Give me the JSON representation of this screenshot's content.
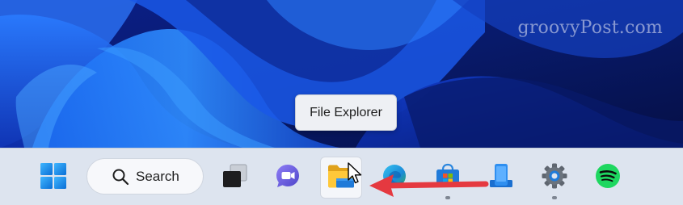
{
  "watermark": "groovyPost.com",
  "tooltip": {
    "text": "File Explorer"
  },
  "taskbar": {
    "search_label": "Search",
    "items": [
      {
        "name": "start",
        "icon": "windows-logo-icon",
        "running": false
      },
      {
        "name": "search",
        "icon": "search-icon",
        "running": false
      },
      {
        "name": "task-view",
        "icon": "task-view-icon",
        "running": false
      },
      {
        "name": "chat",
        "icon": "chat-icon",
        "running": false
      },
      {
        "name": "file-explorer",
        "icon": "folder-icon",
        "running": false,
        "active": true
      },
      {
        "name": "edge",
        "icon": "edge-icon",
        "running": false
      },
      {
        "name": "store",
        "icon": "store-icon",
        "running": true
      },
      {
        "name": "phone-link",
        "icon": "phone-link-icon",
        "running": false
      },
      {
        "name": "settings",
        "icon": "gear-icon",
        "running": true
      },
      {
        "name": "spotify",
        "icon": "spotify-icon",
        "running": false
      }
    ]
  },
  "colors": {
    "taskbar_bg": "#dde4ef",
    "wallpaper_blue": "#1e4fd8",
    "arrow_red": "#e53940",
    "tooltip_bg": "#eef0f4"
  }
}
